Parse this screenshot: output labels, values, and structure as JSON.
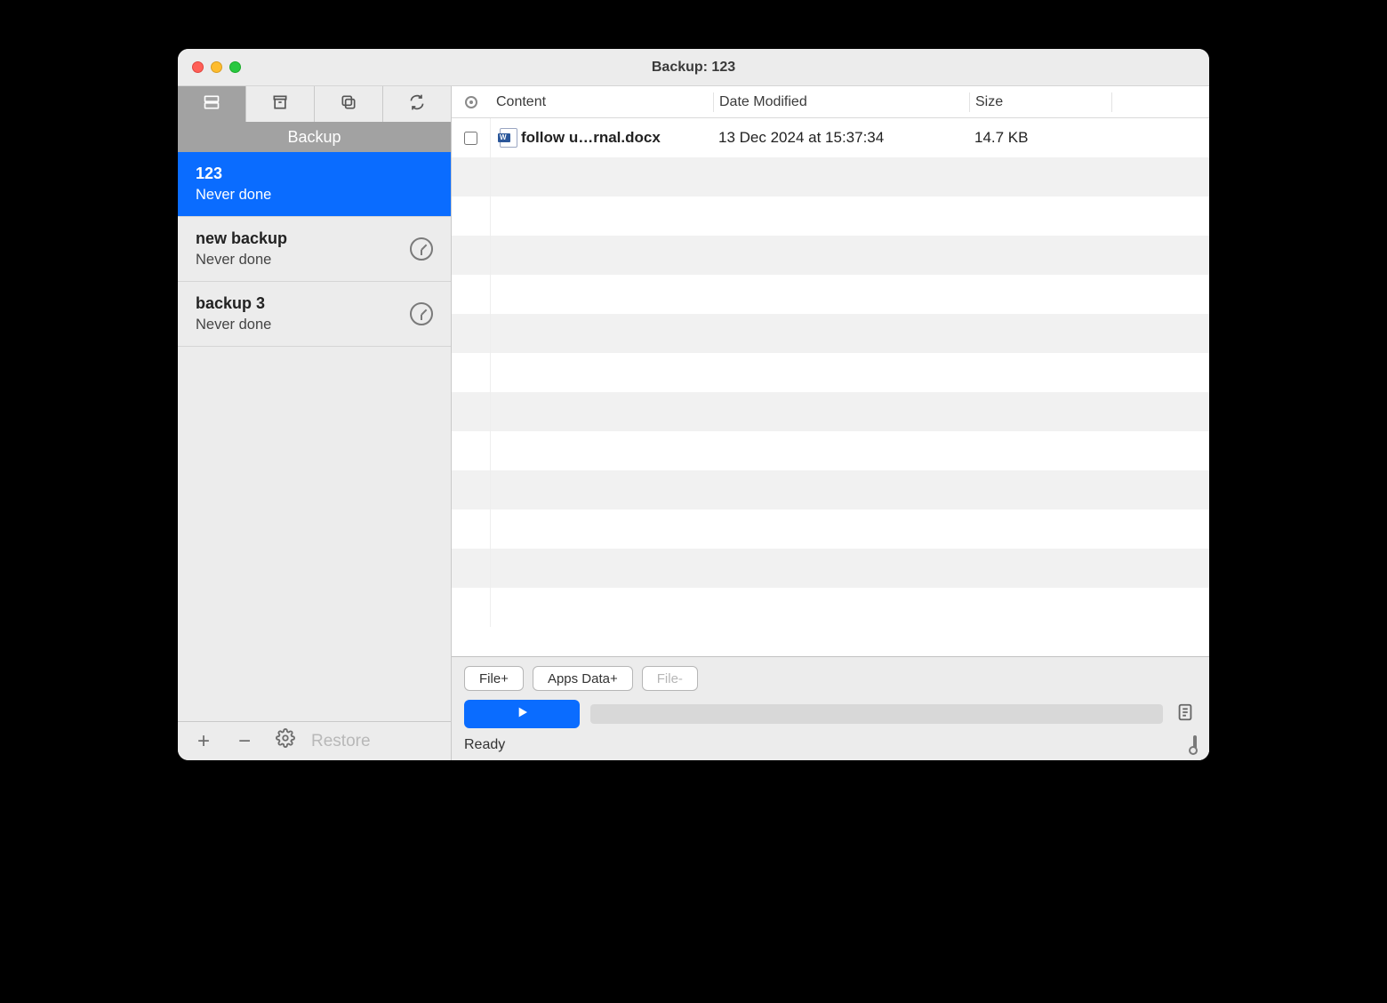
{
  "window": {
    "title": "Backup: 123"
  },
  "sidebar": {
    "tab_label": "Backup",
    "items": [
      {
        "name": "123",
        "sub": "Never done",
        "selected": true,
        "clock": false
      },
      {
        "name": "new backup",
        "sub": "Never done",
        "selected": false,
        "clock": true
      },
      {
        "name": "backup 3",
        "sub": "Never done",
        "selected": false,
        "clock": true
      }
    ],
    "restore_label": "Restore"
  },
  "table": {
    "columns": {
      "content": "Content",
      "date": "Date Modified",
      "size": "Size"
    },
    "rows": [
      {
        "name": "follow u…rnal.docx",
        "date": "13 Dec 2024 at 15:37:34",
        "size": "14.7 KB",
        "checked": false
      }
    ]
  },
  "actions": {
    "file_add": "File+",
    "apps_add": "Apps Data+",
    "file_remove": "File-"
  },
  "status": {
    "ready": "Ready"
  }
}
